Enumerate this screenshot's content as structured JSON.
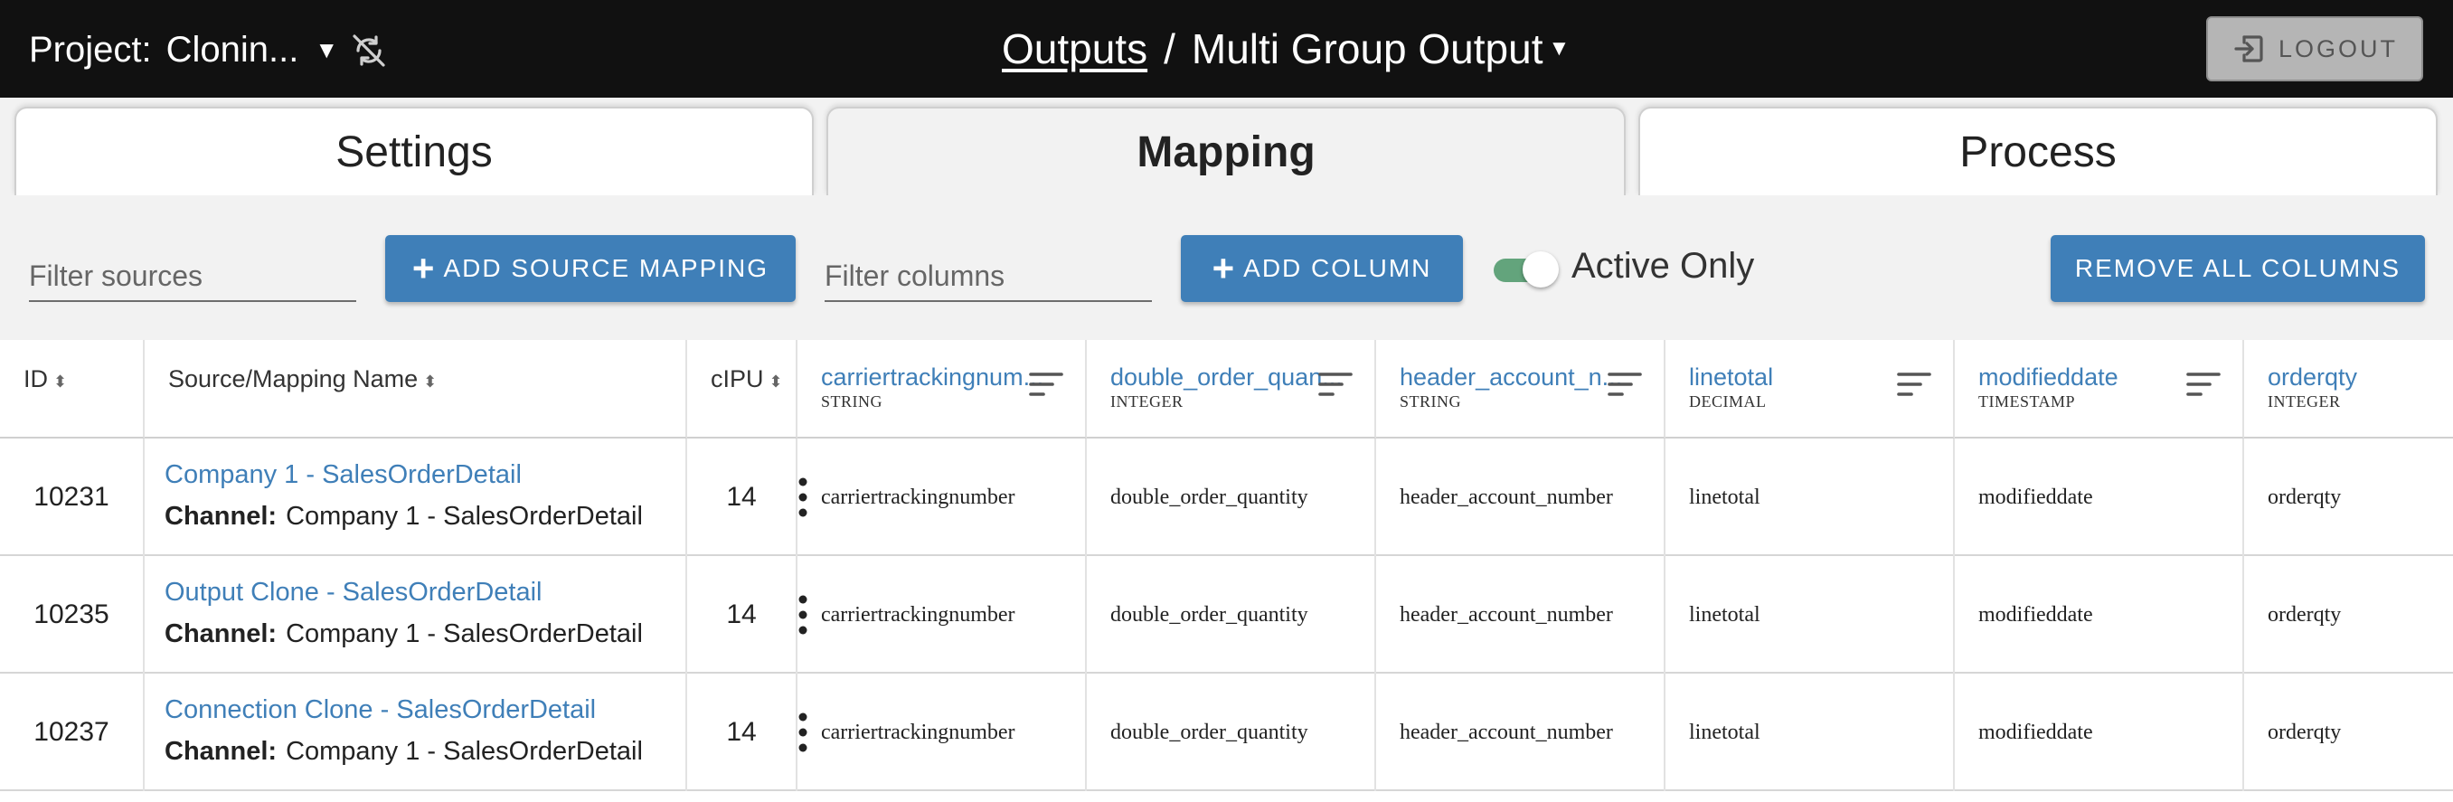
{
  "header": {
    "project_label": "Project:",
    "project_name": "Clonin...",
    "breadcrumb_link": "Outputs",
    "breadcrumb_sep": "/",
    "breadcrumb_current": "Multi Group Output",
    "logout_label": "LOGOUT"
  },
  "tabs": [
    {
      "label": "Settings",
      "active": false
    },
    {
      "label": "Mapping",
      "active": true
    },
    {
      "label": "Process",
      "active": false
    }
  ],
  "toolbar": {
    "filter_sources_placeholder": "Filter sources",
    "add_source_mapping_label": "ADD SOURCE MAPPING",
    "filter_columns_placeholder": "Filter columns",
    "add_column_label": "ADD COLUMN",
    "active_only_label": "Active Only",
    "active_only_on": true,
    "remove_all_columns_label": "REMOVE ALL COLUMNS"
  },
  "table": {
    "fixed_headers": {
      "id": "ID",
      "source": "Source/Mapping Name",
      "cipu": "cIPU"
    },
    "columns": [
      {
        "name": "carriertrackingnum...",
        "type": "STRING"
      },
      {
        "name": "double_order_quan...",
        "type": "INTEGER"
      },
      {
        "name": "header_account_n...",
        "type": "STRING"
      },
      {
        "name": "linetotal",
        "type": "DECIMAL"
      },
      {
        "name": "modifieddate",
        "type": "TIMESTAMP"
      },
      {
        "name": "orderqty",
        "type": "INTEGER"
      }
    ],
    "channel_label": "Channel:",
    "rows": [
      {
        "id": "10231",
        "name": "Company 1 - SalesOrderDetail",
        "channel": "Company 1 - SalesOrderDetail",
        "cipu": "14",
        "values": [
          "carriertrackingnumber",
          "double_order_quantity",
          "header_account_number",
          "linetotal",
          "modifieddate",
          "orderqty"
        ]
      },
      {
        "id": "10235",
        "name": "Output Clone - SalesOrderDetail",
        "channel": "Company 1 - SalesOrderDetail",
        "cipu": "14",
        "values": [
          "carriertrackingnumber",
          "double_order_quantity",
          "header_account_number",
          "linetotal",
          "modifieddate",
          "orderqty"
        ]
      },
      {
        "id": "10237",
        "name": "Connection Clone - SalesOrderDetail",
        "channel": "Company 1 - SalesOrderDetail",
        "cipu": "14",
        "values": [
          "carriertrackingnumber",
          "double_order_quantity",
          "header_account_number",
          "linetotal",
          "modifieddate",
          "orderqty"
        ]
      }
    ]
  },
  "colors": {
    "accent": "#3f7fb8",
    "topbar": "#111111",
    "toggle": "#63a47c"
  },
  "icons": {
    "sync": "sync-disabled-icon",
    "logout": "logout-icon",
    "sort": "sort-icon",
    "kebab": "more-vert-icon"
  }
}
